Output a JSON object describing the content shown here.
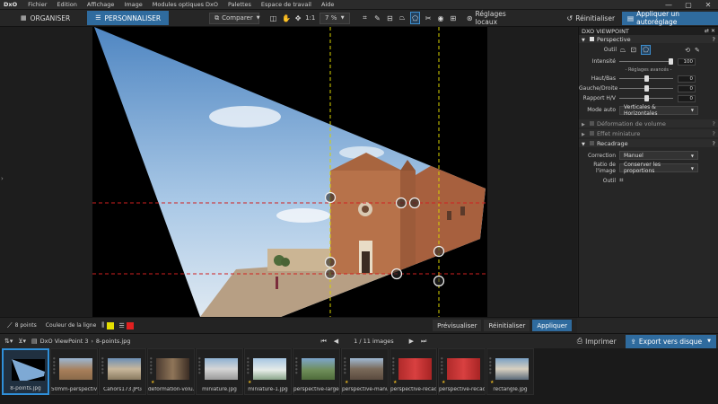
{
  "app": {
    "logo": "DxO"
  },
  "menu": [
    "Fichier",
    "Edition",
    "Affichage",
    "Image",
    "Modules optiques DxO",
    "Palettes",
    "Espace de travail",
    "Aide"
  ],
  "window_controls": [
    "—",
    "▢",
    "✕"
  ],
  "tabs": {
    "organise": "ORGANISER",
    "personalise": "PERSONNALISER"
  },
  "toolbar": {
    "compare": "Comparer",
    "zoom_ratio": "1:1",
    "zoom_level": "7 %",
    "local_settings": "Réglages locaux",
    "reset": "Réinitialiser",
    "apply_auto": "Appliquer un autoréglage"
  },
  "panel": {
    "title": "DXO VIEWPOINT",
    "perspective": {
      "title": "Perspective",
      "tool_label": "Outil",
      "intensity_label": "Intensité",
      "intensity_value": "100",
      "advanced_label": "- Réglages avancés -",
      "hb_label": "Haut/Bas",
      "hb_value": "0",
      "gd_label": "Gauche/Droite",
      "gd_value": "0",
      "ratio_label": "Rapport H/V",
      "ratio_value": "0",
      "mode_label": "Mode auto",
      "mode_value": "Verticales & Horizontales"
    },
    "volume": "Déformation de volume",
    "miniature": "Effet miniature",
    "recadrage": {
      "title": "Recadrage",
      "correction_label": "Correction",
      "correction_value": "Manuel",
      "ratio_label": "Ratio de l'image",
      "ratio_value": "Conserver les proportions",
      "tool_label": "Outil"
    }
  },
  "linebar": {
    "points": "8 points",
    "line_color": "Couleur de la ligne",
    "preview": "Prévisualiser",
    "reset": "Réinitialiser",
    "apply": "Appliquer"
  },
  "colors": {
    "accent": "#2f6b9e",
    "line_yellow": "#e5e000",
    "line_red": "#e02020"
  },
  "filmstrip_bar": {
    "project": "DxO ViewPoint 3",
    "file": "8-points.jpg",
    "pager": "1 / 11  images",
    "print": "Imprimer",
    "export": "Export vers disque"
  },
  "thumbnails": [
    {
      "name": "8-points.jpg"
    },
    {
      "name": "50mm-perspective..."
    },
    {
      "name": "Cahors173.JPG"
    },
    {
      "name": "deformation-volu..."
    },
    {
      "name": "miniature.jpg"
    },
    {
      "name": "miniature-1.jpg"
    },
    {
      "name": "perspective-large.j..."
    },
    {
      "name": "perspective-manu..."
    },
    {
      "name": "perspective-recad 1"
    },
    {
      "name": "perspective-recad 2"
    },
    {
      "name": "rectangle.jpg"
    }
  ]
}
